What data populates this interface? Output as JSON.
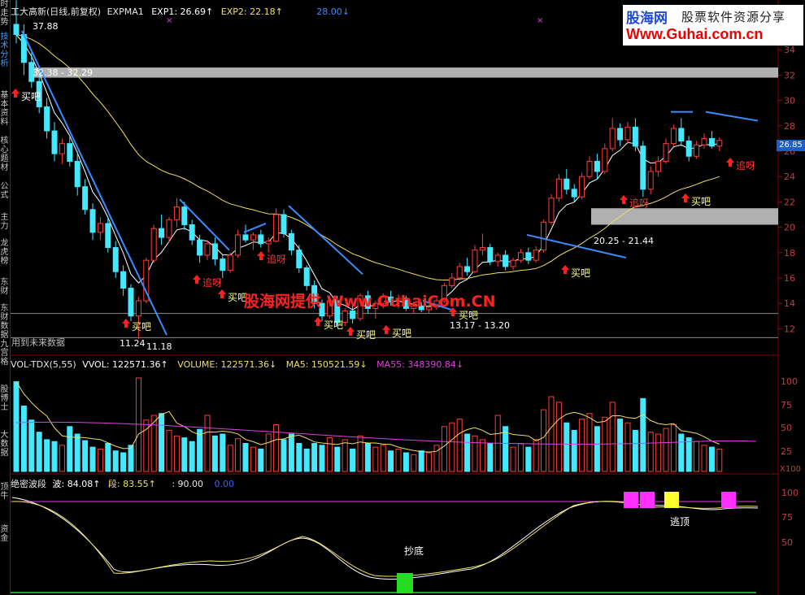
{
  "sidebar": {
    "tabs": [
      {
        "label": "时走势",
        "active": false
      },
      {
        "label": "技术分析",
        "active": true
      },
      {
        "label": "基本资料",
        "active": false
      },
      {
        "label": "核心题材",
        "active": false
      },
      {
        "label": "公式",
        "active": false
      },
      {
        "label": "主力",
        "active": false
      },
      {
        "label": "龙虎榜",
        "active": false
      },
      {
        "label": "东财",
        "active": false
      },
      {
        "label": "东财数据",
        "active": false
      },
      {
        "label": "九宫格",
        "active": false
      },
      {
        "label": "股博士",
        "active": false
      },
      {
        "label": "大数据",
        "active": false
      },
      {
        "label": "顶牛",
        "active": false
      },
      {
        "label": "资金",
        "active": false
      }
    ]
  },
  "logo": {
    "line1": "股海网",
    "line2": "股票软件资源分享",
    "line3": "Www.Guhai.com.cn"
  },
  "watermark": "股海网提供 Www.GuhaiCom.CN",
  "price_header": {
    "title": "工大高新(日线,前复权)",
    "ind": "EXPMA1",
    "exp1": "EXP1: 26.69↑",
    "exp2": "EXP2: 22.18↑",
    "exp3": "28.00↓"
  },
  "vol_header": {
    "name": "VOL-TDX(5,55)",
    "vvol": "VVOL: 122571.36↑",
    "volume": "VOLUME: 122571.36↓",
    "ma5": "MA5: 150521.59↓",
    "ma55": "MA55: 348390.84↓"
  },
  "wave_header": {
    "name": "绝密波段",
    "wave": "波: 84.08↑",
    "seg": "段: 83.55↑",
    "v3": ": 90.00",
    "v4": "0.00"
  },
  "current_price": "26.85",
  "axes": {
    "price_ticks": [
      "34",
      "32",
      "30",
      "28",
      "26",
      "24",
      "22",
      "20",
      "18",
      "16",
      "14",
      "12"
    ],
    "vol_ticks": [
      "100",
      "75",
      "50",
      "25",
      "X100"
    ],
    "wave_ticks": [
      "100",
      "75",
      "50"
    ]
  },
  "annotations": {
    "high": "37.88",
    "zone1": "32.38 - 32.29",
    "zone2": "20.25 - 21.44",
    "zone3": "13.17 - 13.20",
    "low": "11.24",
    "low2": "11.18",
    "future": "用到未来数据",
    "buy": "买吧",
    "chase": "追呀",
    "bottom": "抄底",
    "escape": "逃顶"
  },
  "colors": {
    "up": "#ff3c3c",
    "down": "#44e8ff",
    "exp1": "#ffffff",
    "exp2": "#f0e060",
    "trend": "#3a8cff",
    "zone": "#b0b0b0",
    "ma55": "#e040e0"
  },
  "chart_data": {
    "type": "candlestick",
    "price_range": [
      11,
      36
    ],
    "candles": [
      [
        36.0,
        37.9,
        34.5,
        35.2
      ],
      [
        35.2,
        36.0,
        32.0,
        33.0
      ],
      [
        33.0,
        33.8,
        31.0,
        31.5
      ],
      [
        31.5,
        32.2,
        29.0,
        29.5
      ],
      [
        29.5,
        30.2,
        27.0,
        27.6
      ],
      [
        27.6,
        28.3,
        25.2,
        25.8
      ],
      [
        25.8,
        27.0,
        25.0,
        26.6
      ],
      [
        26.6,
        27.2,
        24.8,
        25.2
      ],
      [
        25.2,
        26.0,
        22.5,
        23.2
      ],
      [
        23.2,
        23.8,
        21.0,
        21.4
      ],
      [
        21.4,
        21.9,
        19.0,
        19.6
      ],
      [
        19.6,
        20.8,
        19.0,
        20.3
      ],
      [
        20.3,
        20.8,
        18.0,
        18.4
      ],
      [
        18.4,
        18.9,
        16.0,
        16.5
      ],
      [
        16.5,
        17.0,
        14.6,
        15.2
      ],
      [
        15.2,
        15.5,
        12.6,
        13.0
      ],
      [
        13.0,
        14.5,
        11.2,
        14.2
      ],
      [
        14.2,
        17.6,
        14.0,
        17.4
      ],
      [
        17.4,
        20.2,
        17.2,
        19.9
      ],
      [
        19.9,
        21.0,
        18.6,
        19.2
      ],
      [
        19.2,
        20.8,
        18.8,
        20.6
      ],
      [
        20.6,
        22.3,
        20.0,
        21.6
      ],
      [
        21.6,
        22.0,
        19.8,
        20.2
      ],
      [
        20.2,
        20.6,
        18.6,
        19.0
      ],
      [
        19.0,
        19.4,
        17.2,
        17.8
      ],
      [
        17.8,
        19.0,
        17.4,
        18.7
      ],
      [
        18.7,
        19.2,
        17.0,
        17.5
      ],
      [
        17.5,
        17.9,
        16.0,
        16.6
      ],
      [
        16.6,
        18.0,
        16.4,
        17.8
      ],
      [
        17.8,
        19.8,
        17.6,
        19.4
      ],
      [
        19.4,
        20.2,
        18.8,
        19.0
      ],
      [
        19.0,
        19.6,
        18.2,
        19.4
      ],
      [
        19.4,
        19.8,
        18.4,
        18.7
      ],
      [
        18.7,
        19.2,
        18.0,
        18.9
      ],
      [
        18.9,
        21.5,
        18.8,
        21.0
      ],
      [
        21.0,
        21.4,
        19.2,
        19.5
      ],
      [
        19.5,
        19.8,
        17.8,
        18.2
      ],
      [
        18.2,
        18.6,
        16.4,
        16.8
      ],
      [
        16.8,
        17.0,
        15.0,
        15.4
      ],
      [
        15.4,
        15.8,
        13.6,
        14.0
      ],
      [
        14.0,
        14.3,
        12.6,
        13.0
      ],
      [
        13.0,
        14.4,
        12.8,
        14.2
      ],
      [
        14.2,
        14.6,
        12.2,
        12.5
      ],
      [
        12.5,
        13.6,
        12.2,
        13.4
      ],
      [
        13.4,
        13.8,
        12.4,
        12.8
      ],
      [
        12.8,
        14.8,
        12.6,
        14.6
      ],
      [
        14.6,
        15.0,
        13.2,
        13.6
      ],
      [
        13.6,
        14.2,
        12.8,
        14.0
      ],
      [
        14.0,
        14.8,
        13.6,
        14.5
      ],
      [
        14.5,
        15.0,
        13.8,
        14.2
      ],
      [
        14.2,
        14.7,
        13.6,
        14.4
      ],
      [
        14.4,
        14.6,
        13.4,
        13.6
      ],
      [
        13.6,
        14.0,
        13.2,
        13.8
      ],
      [
        13.8,
        14.1,
        13.3,
        13.5
      ],
      [
        13.5,
        13.9,
        13.2,
        13.7
      ],
      [
        13.7,
        14.4,
        13.5,
        14.2
      ],
      [
        14.2,
        15.6,
        14.0,
        15.4
      ],
      [
        15.4,
        16.4,
        15.2,
        16.0
      ],
      [
        16.0,
        17.2,
        15.8,
        16.9
      ],
      [
        16.9,
        17.6,
        16.2,
        16.5
      ],
      [
        16.5,
        18.6,
        16.4,
        18.2
      ],
      [
        18.2,
        19.5,
        17.8,
        18.4
      ],
      [
        18.4,
        18.7,
        17.0,
        17.3
      ],
      [
        17.3,
        18.0,
        16.9,
        17.8
      ],
      [
        17.8,
        18.2,
        16.6,
        16.9
      ],
      [
        16.9,
        17.6,
        16.6,
        17.4
      ],
      [
        17.4,
        18.3,
        17.2,
        18.0
      ],
      [
        18.0,
        18.4,
        17.1,
        17.4
      ],
      [
        17.4,
        18.5,
        17.2,
        18.2
      ],
      [
        18.2,
        20.6,
        18.0,
        20.4
      ],
      [
        20.4,
        22.6,
        20.2,
        22.3
      ],
      [
        22.3,
        24.2,
        22.0,
        23.8
      ],
      [
        23.8,
        24.6,
        22.6,
        23.0
      ],
      [
        23.0,
        23.4,
        22.0,
        22.4
      ],
      [
        22.4,
        24.3,
        22.2,
        24.0
      ],
      [
        24.0,
        25.6,
        23.8,
        25.2
      ],
      [
        25.2,
        25.8,
        23.8,
        24.4
      ],
      [
        24.4,
        26.6,
        24.2,
        26.2
      ],
      [
        26.2,
        28.6,
        26.0,
        27.8
      ],
      [
        27.8,
        28.2,
        26.4,
        26.9
      ],
      [
        26.9,
        28.3,
        26.6,
        27.9
      ],
      [
        27.9,
        28.6,
        26.0,
        26.4
      ],
      [
        26.4,
        26.8,
        22.4,
        23.0
      ],
      [
        23.0,
        24.8,
        22.6,
        24.4
      ],
      [
        24.4,
        25.6,
        24.0,
        25.2
      ],
      [
        25.2,
        27.0,
        25.0,
        26.6
      ],
      [
        26.6,
        28.1,
        26.4,
        27.8
      ],
      [
        27.8,
        28.6,
        26.4,
        26.8
      ],
      [
        26.8,
        27.2,
        25.2,
        25.6
      ],
      [
        25.6,
        26.8,
        25.4,
        26.5
      ],
      [
        26.5,
        27.4,
        26.2,
        27.0
      ],
      [
        27.0,
        27.6,
        26.2,
        26.4
      ],
      [
        26.4,
        27.1,
        26.0,
        26.85
      ]
    ],
    "volume_labels": "VOLUME (x100)",
    "wave_levels": {
      "top_line": 90,
      "bottom_line": 0
    }
  }
}
